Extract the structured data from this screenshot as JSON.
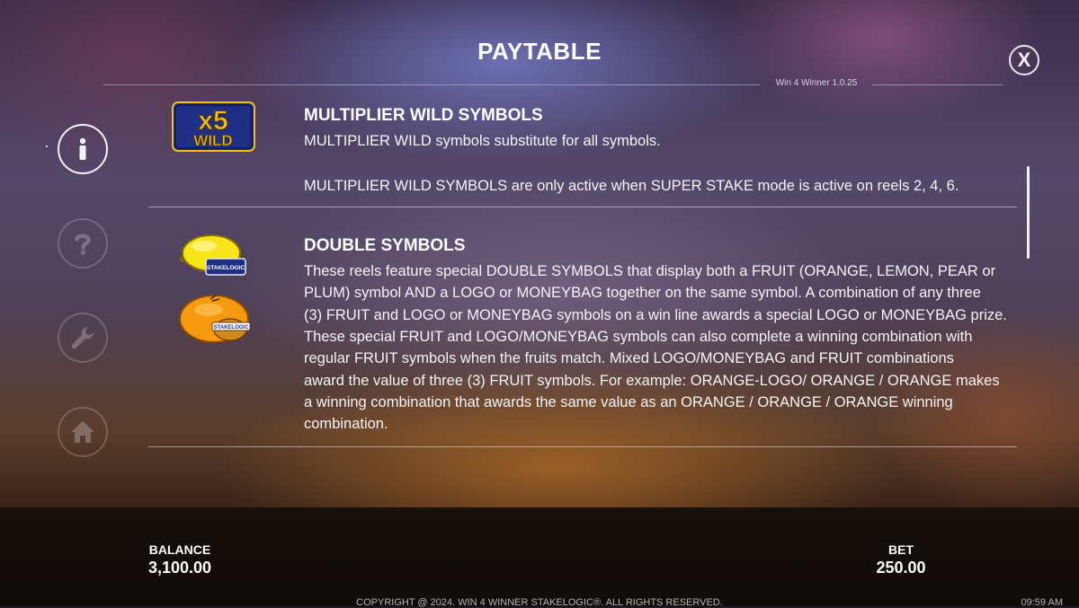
{
  "header": {
    "title": "PAYTABLE",
    "version": "Win 4 Winner 1.0.25",
    "close_label": "X"
  },
  "sidebar": {
    "items": [
      {
        "icon": "info-icon",
        "active": true
      },
      {
        "icon": "help-icon",
        "active": false
      },
      {
        "icon": "wrench-icon",
        "active": false
      },
      {
        "icon": "home-icon",
        "active": false
      }
    ]
  },
  "sections": [
    {
      "title": "MULTIPLIER WILD SYMBOLS",
      "lines": [
        "MULTIPLIER WILD symbols substitute for all symbols.",
        "MULTIPLIER WILD SYMBOLS are only active when SUPER STAKE mode is active on reels 2, 4, 6."
      ],
      "symbol": {
        "top": "x5",
        "bottom": "WILD"
      }
    },
    {
      "title": "DOUBLE SYMBOLS",
      "lines": [
        "These reels feature special DOUBLE SYMBOLS that display both a FRUIT (ORANGE, LEMON, PEAR or",
        "PLUM) symbol AND a LOGO or MONEYBAG together on the same symbol. A combination of any three",
        "(3) FRUIT and LOGO or MONEYBAG symbols on a win line awards a special LOGO or MONEYBAG prize.",
        "These special FRUIT and LOGO/MONEYBAG symbols can also complete a winning combination with",
        "regular FRUIT symbols when the fruits match. Mixed LOGO/MONEYBAG and FRUIT combinations",
        "award the value of three (3) FRUIT symbols. For example: ORANGE-LOGO/ ORANGE / ORANGE makes",
        "a winning combination that awards the same value as an ORANGE / ORANGE / ORANGE winning",
        "combination."
      ],
      "symbol_badges": {
        "lemon_badge": "STAKELOGIC",
        "orange_badge": "STAKELOGIC"
      }
    }
  ],
  "footer": {
    "balance_label": "BALANCE",
    "balance_value": "3,100.00",
    "bet_label": "BET",
    "bet_value": "250.00",
    "copyright": "COPYRIGHT @ 2024. WIN 4 WINNER STAKELOGIC®. ALL RIGHTS RESERVED.",
    "clock": "09:59 AM"
  },
  "colors": {
    "wild_gold": "#f2c21a",
    "wild_blue": "#1f2f86",
    "lemon": "#f7e51a",
    "orange": "#f59a0f"
  }
}
